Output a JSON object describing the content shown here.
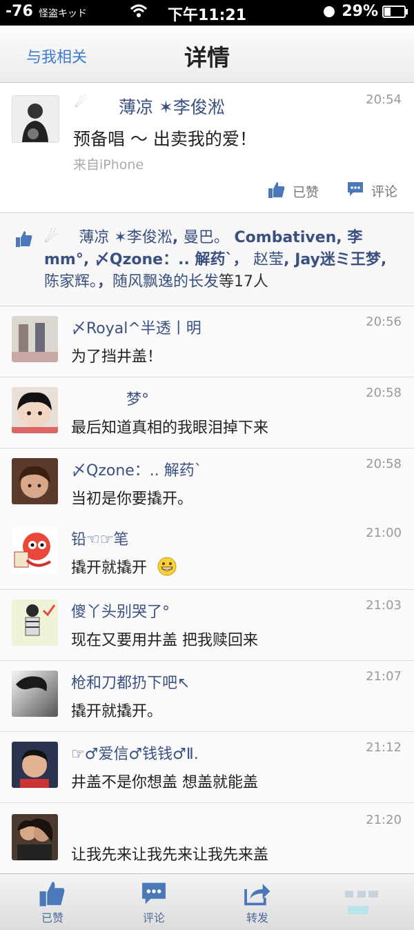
{
  "status_bar": {
    "signal": "-76",
    "carrier": "怪盗キッド",
    "time": "下午11:21",
    "battery": "29%"
  },
  "nav": {
    "back_label": "与我相关",
    "title": "详情"
  },
  "post": {
    "author": "薄凉 ✶李俊淞",
    "time": "20:54",
    "text": "预备唱 ～ 出卖我的爱！",
    "source": "来自iPhone",
    "like_label": "已赞",
    "comment_label": "评论"
  },
  "likes": {
    "names": [
      "薄凉 ✶李俊淞",
      "曼巴。",
      "Combativen",
      "李mm°",
      "〆Qzone：.. 解药`",
      "赵莹",
      "Jay迷ミ王梦",
      "陈家辉。",
      "随风飘逸的长发"
    ],
    "suffix": "等17人"
  },
  "comments": [
    {
      "name": "〆Royal^半透丨明",
      "time": "20:56",
      "text": "为了挡井盖！"
    },
    {
      "name": "梦°",
      "time": "20:58",
      "text": "最后知道真相的我眼泪掉下来"
    },
    {
      "name": "〆Qzone：.. 解药`",
      "time": "20:58",
      "text": "当初是你要撬开。"
    },
    {
      "name": "铅☜☞笔",
      "time": "21:00",
      "text": "撬开就撬开"
    },
    {
      "name": "傻丫头别哭了°",
      "time": "21:03",
      "text": "现在又要用井盖 把我赎回来"
    },
    {
      "name": "枪和刀都扔下吧↖",
      "time": "21:07",
      "text": "撬开就撬开。"
    },
    {
      "name": "☞♂爱信♂钱钱♂Ⅱ.",
      "time": "21:12",
      "text": "井盖不是你想盖 想盖就能盖"
    },
    {
      "name": "",
      "time": "21:20",
      "text": "让我先来让我先来让我先来盖"
    }
  ],
  "tab_bar": {
    "like_label": "已赞",
    "comment_label": "评论",
    "forward_label": "转发"
  },
  "colors": {
    "link": "#3a5080",
    "accent": "#3b7bd0",
    "icon": "#4a6a98"
  }
}
